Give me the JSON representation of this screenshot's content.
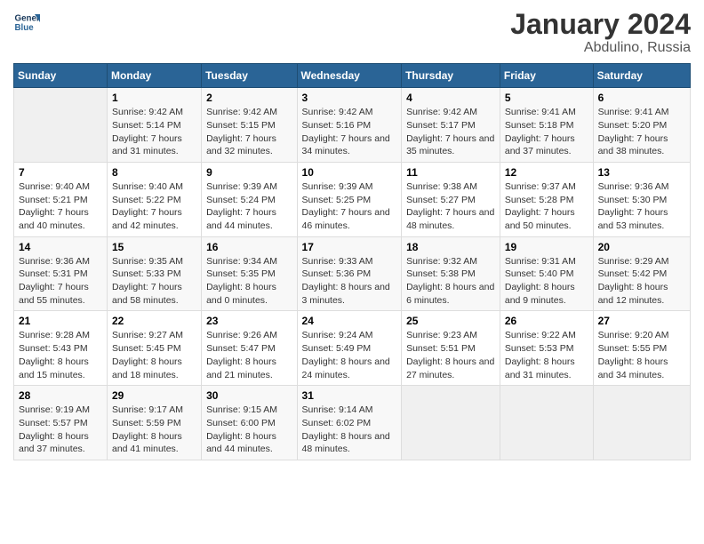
{
  "header": {
    "logo_line1": "General",
    "logo_line2": "Blue",
    "title": "January 2024",
    "location": "Abdulino, Russia"
  },
  "weekdays": [
    "Sunday",
    "Monday",
    "Tuesday",
    "Wednesday",
    "Thursday",
    "Friday",
    "Saturday"
  ],
  "weeks": [
    [
      {
        "day": "",
        "empty": true
      },
      {
        "day": "1",
        "sunrise": "9:42 AM",
        "sunset": "5:14 PM",
        "daylight": "7 hours and 31 minutes."
      },
      {
        "day": "2",
        "sunrise": "9:42 AM",
        "sunset": "5:15 PM",
        "daylight": "7 hours and 32 minutes."
      },
      {
        "day": "3",
        "sunrise": "9:42 AM",
        "sunset": "5:16 PM",
        "daylight": "7 hours and 34 minutes."
      },
      {
        "day": "4",
        "sunrise": "9:42 AM",
        "sunset": "5:17 PM",
        "daylight": "7 hours and 35 minutes."
      },
      {
        "day": "5",
        "sunrise": "9:41 AM",
        "sunset": "5:18 PM",
        "daylight": "7 hours and 37 minutes."
      },
      {
        "day": "6",
        "sunrise": "9:41 AM",
        "sunset": "5:20 PM",
        "daylight": "7 hours and 38 minutes."
      }
    ],
    [
      {
        "day": "7",
        "sunrise": "9:40 AM",
        "sunset": "5:21 PM",
        "daylight": "7 hours and 40 minutes."
      },
      {
        "day": "8",
        "sunrise": "9:40 AM",
        "sunset": "5:22 PM",
        "daylight": "7 hours and 42 minutes."
      },
      {
        "day": "9",
        "sunrise": "9:39 AM",
        "sunset": "5:24 PM",
        "daylight": "7 hours and 44 minutes."
      },
      {
        "day": "10",
        "sunrise": "9:39 AM",
        "sunset": "5:25 PM",
        "daylight": "7 hours and 46 minutes."
      },
      {
        "day": "11",
        "sunrise": "9:38 AM",
        "sunset": "5:27 PM",
        "daylight": "7 hours and 48 minutes."
      },
      {
        "day": "12",
        "sunrise": "9:37 AM",
        "sunset": "5:28 PM",
        "daylight": "7 hours and 50 minutes."
      },
      {
        "day": "13",
        "sunrise": "9:36 AM",
        "sunset": "5:30 PM",
        "daylight": "7 hours and 53 minutes."
      }
    ],
    [
      {
        "day": "14",
        "sunrise": "9:36 AM",
        "sunset": "5:31 PM",
        "daylight": "7 hours and 55 minutes."
      },
      {
        "day": "15",
        "sunrise": "9:35 AM",
        "sunset": "5:33 PM",
        "daylight": "7 hours and 58 minutes."
      },
      {
        "day": "16",
        "sunrise": "9:34 AM",
        "sunset": "5:35 PM",
        "daylight": "8 hours and 0 minutes."
      },
      {
        "day": "17",
        "sunrise": "9:33 AM",
        "sunset": "5:36 PM",
        "daylight": "8 hours and 3 minutes."
      },
      {
        "day": "18",
        "sunrise": "9:32 AM",
        "sunset": "5:38 PM",
        "daylight": "8 hours and 6 minutes."
      },
      {
        "day": "19",
        "sunrise": "9:31 AM",
        "sunset": "5:40 PM",
        "daylight": "8 hours and 9 minutes."
      },
      {
        "day": "20",
        "sunrise": "9:29 AM",
        "sunset": "5:42 PM",
        "daylight": "8 hours and 12 minutes."
      }
    ],
    [
      {
        "day": "21",
        "sunrise": "9:28 AM",
        "sunset": "5:43 PM",
        "daylight": "8 hours and 15 minutes."
      },
      {
        "day": "22",
        "sunrise": "9:27 AM",
        "sunset": "5:45 PM",
        "daylight": "8 hours and 18 minutes."
      },
      {
        "day": "23",
        "sunrise": "9:26 AM",
        "sunset": "5:47 PM",
        "daylight": "8 hours and 21 minutes."
      },
      {
        "day": "24",
        "sunrise": "9:24 AM",
        "sunset": "5:49 PM",
        "daylight": "8 hours and 24 minutes."
      },
      {
        "day": "25",
        "sunrise": "9:23 AM",
        "sunset": "5:51 PM",
        "daylight": "8 hours and 27 minutes."
      },
      {
        "day": "26",
        "sunrise": "9:22 AM",
        "sunset": "5:53 PM",
        "daylight": "8 hours and 31 minutes."
      },
      {
        "day": "27",
        "sunrise": "9:20 AM",
        "sunset": "5:55 PM",
        "daylight": "8 hours and 34 minutes."
      }
    ],
    [
      {
        "day": "28",
        "sunrise": "9:19 AM",
        "sunset": "5:57 PM",
        "daylight": "8 hours and 37 minutes."
      },
      {
        "day": "29",
        "sunrise": "9:17 AM",
        "sunset": "5:59 PM",
        "daylight": "8 hours and 41 minutes."
      },
      {
        "day": "30",
        "sunrise": "9:15 AM",
        "sunset": "6:00 PM",
        "daylight": "8 hours and 44 minutes."
      },
      {
        "day": "31",
        "sunrise": "9:14 AM",
        "sunset": "6:02 PM",
        "daylight": "8 hours and 48 minutes."
      },
      {
        "day": "",
        "empty": true
      },
      {
        "day": "",
        "empty": true
      },
      {
        "day": "",
        "empty": true
      }
    ]
  ]
}
